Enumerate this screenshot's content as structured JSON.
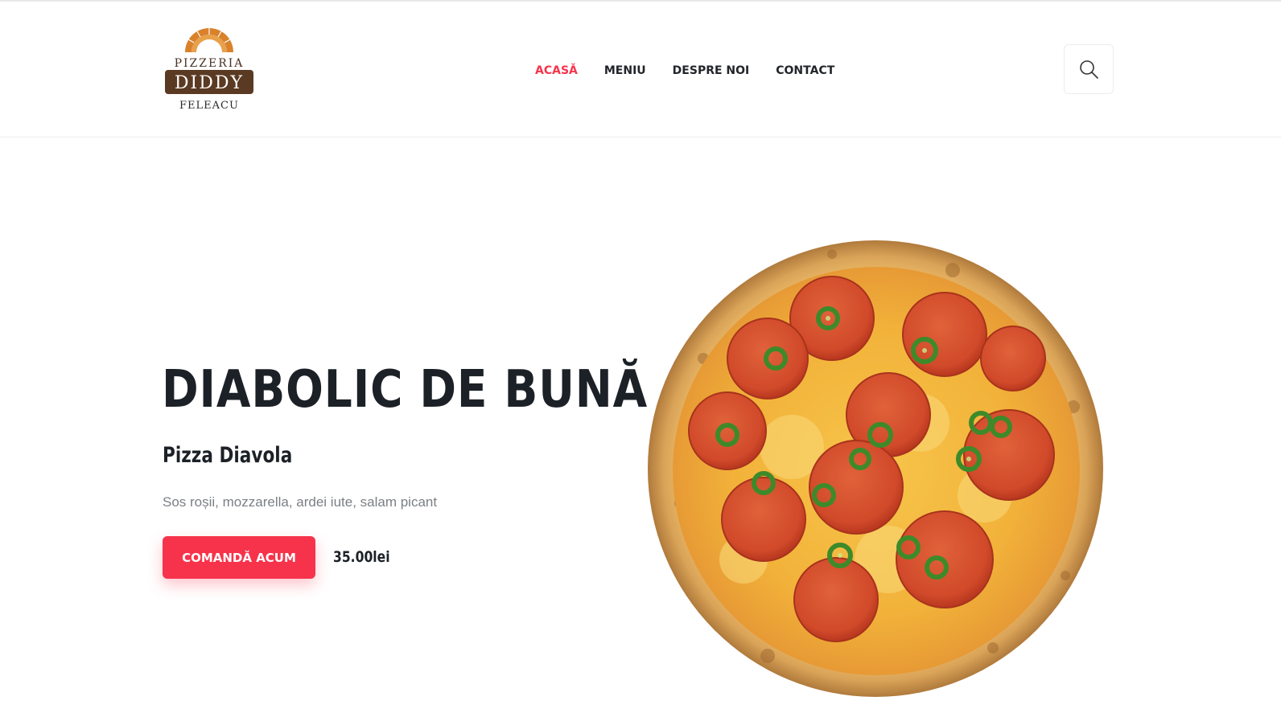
{
  "brand": {
    "logo_top": "PIZZERIA",
    "logo_main": "DIDDY",
    "logo_bottom": "FELEACU",
    "colors": {
      "accent": "#f7334b",
      "logo_brown": "#5a3a22",
      "logo_orange": "#d9822b"
    }
  },
  "nav": {
    "items": [
      {
        "label": "ACASĂ",
        "active": true
      },
      {
        "label": "MENIU",
        "active": false
      },
      {
        "label": "DESPRE NOI",
        "active": false
      },
      {
        "label": "CONTACT",
        "active": false
      }
    ]
  },
  "header": {
    "search_icon": "search-icon"
  },
  "hero": {
    "title": "DIABOLIC DE BUNĂ",
    "subtitle": "Pizza Diavola",
    "description": "Sos roșii, mozzarella, ardei iute, salam picant",
    "cta_label": "COMANDĂ ACUM",
    "price": "35.00lei",
    "image": "pizza-diavola-image"
  }
}
